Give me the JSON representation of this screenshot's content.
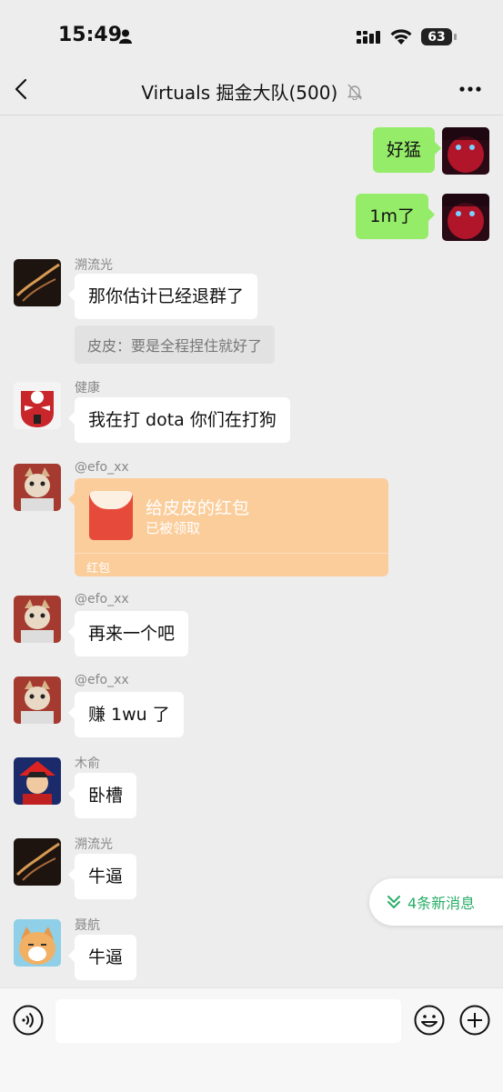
{
  "status_bar": {
    "time": "15:49",
    "battery": "63"
  },
  "nav": {
    "title": "Virtuals 掘金大队(500)"
  },
  "messages": [
    {
      "sender": "",
      "text": "好猛",
      "outgoing": true
    },
    {
      "sender": "",
      "text": "1m了",
      "outgoing": true
    },
    {
      "sender": "溯流光",
      "text": "那你估计已经退群了",
      "quote": "皮皮：要是全程捏住就好了"
    },
    {
      "sender": "健康",
      "text": "我在打 dota 你们在打狗"
    },
    {
      "sender": "@efo_xx",
      "red_packet": {
        "title": "给皮皮的红包",
        "status": "已被领取",
        "label": "红包"
      }
    },
    {
      "sender": "@efo_xx",
      "text": "再来一个吧"
    },
    {
      "sender": "@efo_xx",
      "text": "赚 1wu 了"
    },
    {
      "sender": "木俞",
      "text": "卧槽"
    },
    {
      "sender": "溯流光",
      "text": "牛逼"
    },
    {
      "sender": "聂航",
      "text": "牛逼"
    }
  ],
  "new_messages": {
    "label": "4条新消息"
  },
  "colors": {
    "outgoing_bubble": "#95ec69",
    "red_packet": "#fbcd9a",
    "accent": "#2aae67"
  },
  "icons": [
    "back-icon",
    "mute-icon",
    "more-icon",
    "voice-icon",
    "emoji-icon",
    "plus-icon",
    "chevron-down-double-icon"
  ]
}
